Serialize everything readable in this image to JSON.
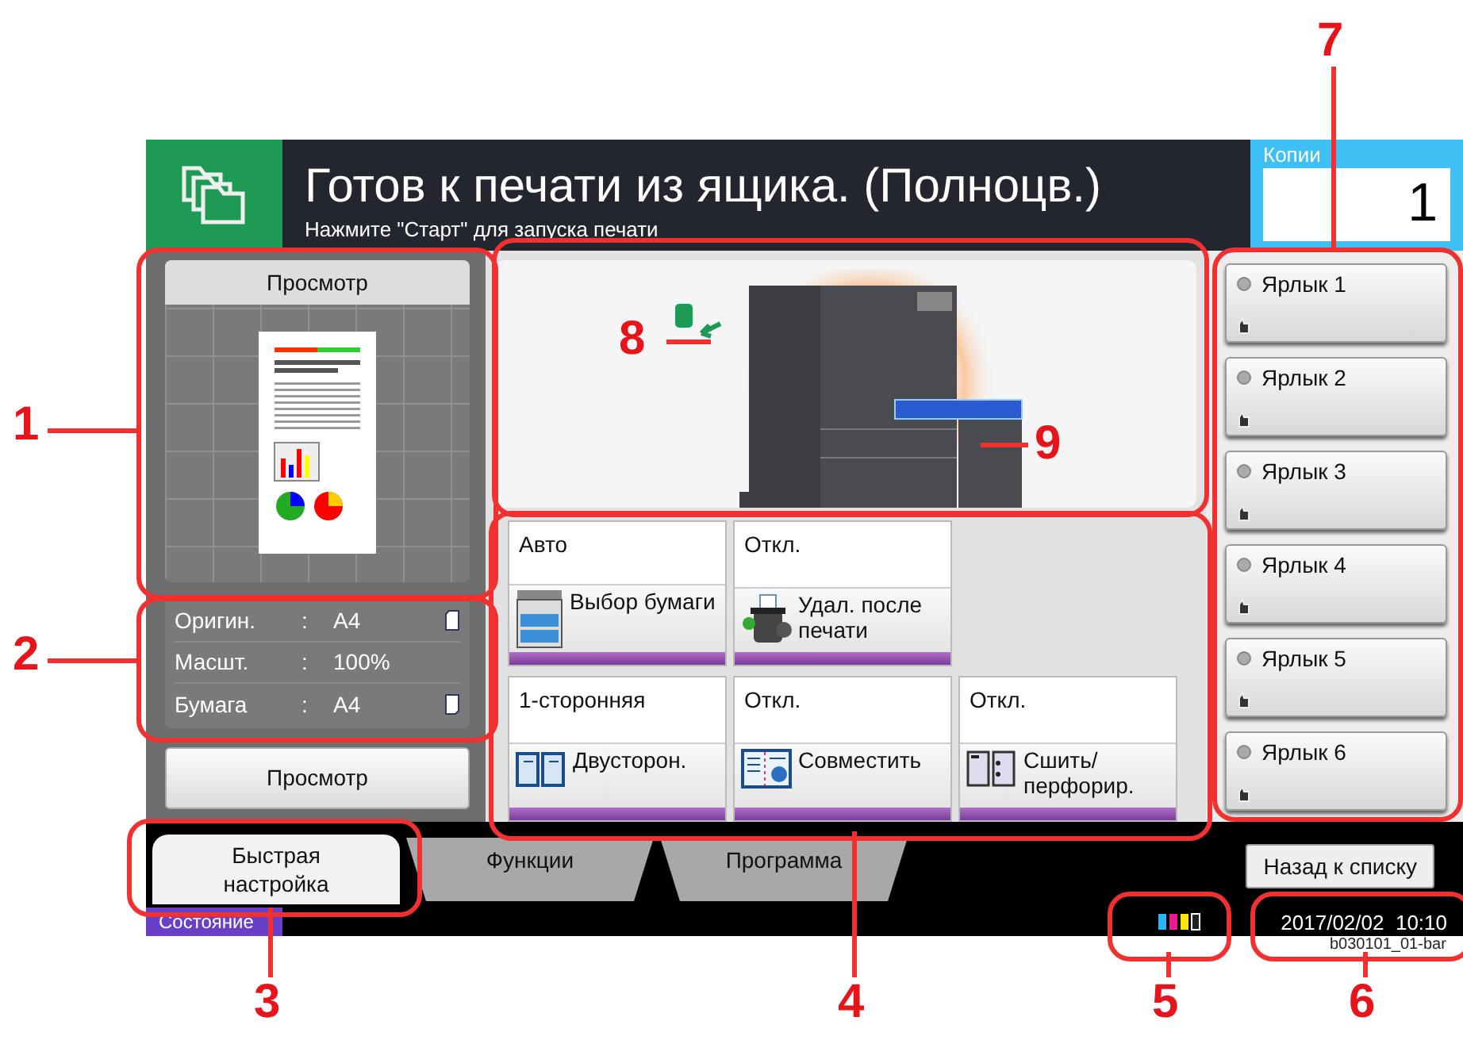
{
  "header": {
    "title": "Готов к печати из ящика. (Полноцв.)",
    "subtitle": "Нажмите \"Старт\" для запуска печати",
    "copies_label": "Копии",
    "copies": "1"
  },
  "preview": {
    "title": "Просмотр"
  },
  "info": [
    {
      "label": "Оригин.",
      "colon": ":",
      "value": "A4",
      "kind": "original"
    },
    {
      "label": "Масшт.",
      "colon": ":",
      "value": "100%",
      "kind": "plain"
    },
    {
      "label": "Бумага",
      "colon": ":",
      "value": "A4",
      "kind": "paper"
    }
  ],
  "preview_button": "Просмотр",
  "functions": [
    {
      "value": "Авто",
      "label": "Выбор бумаги",
      "kind": "paper-select"
    },
    {
      "value": "Откл.",
      "label": "Удал. после печати",
      "kind": "delete"
    },
    {
      "kind": "blank"
    },
    {
      "value": "1-сторонняя",
      "label": "Двусторон.",
      "kind": "duplex"
    },
    {
      "value": "Откл.",
      "label": "Совместить",
      "kind": "combine"
    },
    {
      "value": "Откл.",
      "label": "Сшить/ перфорир.",
      "kind": "staple"
    }
  ],
  "shortcuts": [
    "Ярлык 1",
    "Ярлык 2",
    "Ярлык 3",
    "Ярлык 4",
    "Ярлык 5",
    "Ярлык 6"
  ],
  "tabs": [
    {
      "label": "Быстрая настройка",
      "selected": true
    },
    {
      "label": "Функции",
      "selected": false
    },
    {
      "label": "Программа",
      "selected": false
    }
  ],
  "back_button": "Назад к списку",
  "status": {
    "label": "Состояние",
    "datetime": "2017/02/02  10:10"
  },
  "callouts": [
    "1",
    "2",
    "3",
    "4",
    "5",
    "6",
    "7",
    "8",
    "9"
  ],
  "image_code": "b030101_01-bar"
}
